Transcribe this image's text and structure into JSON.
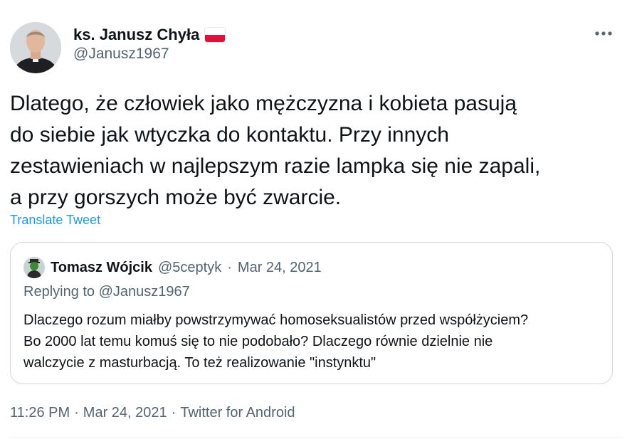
{
  "tweet": {
    "author": {
      "name": "ks. Janusz Chyła",
      "flag": "flag-poland-icon",
      "handle": "@Janusz1967"
    },
    "more_icon": "more-horizontal-icon",
    "text": "Dlatego, że człowiek jako mężczyzna i kobieta pasują\ndo siebie jak wtyczka do kontaktu. Przy innych\nzestawieniach w najlepszym razie lampka się nie zapali,\na przy gorszych może być zwarcie.",
    "translate_label": "Translate Tweet",
    "quoted": {
      "name": "Tomasz Wójcik",
      "handle": "@5ceptyk",
      "separator": "·",
      "date": "Mar 24, 2021",
      "replying_to": "Replying to @Janusz1967",
      "text": "Dlaczego rozum miałby powstrzymywać homoseksualistów przed współżyciem?\nBo 2000 lat temu komuś się to nie podobało? Dlaczego równie dzielnie nie\nwalczycie z masturbacją. To też realizowanie \"instynktu\""
    },
    "meta": {
      "time": "11:26 PM",
      "separator": "·",
      "date": "Mar 24, 2021",
      "source": "Twitter for Android"
    }
  },
  "colors": {
    "text_primary": "#0f1419",
    "text_secondary": "#536471",
    "link": "#1d9bf0",
    "border": "#cfd9de",
    "flag_red": "#dc143c"
  }
}
